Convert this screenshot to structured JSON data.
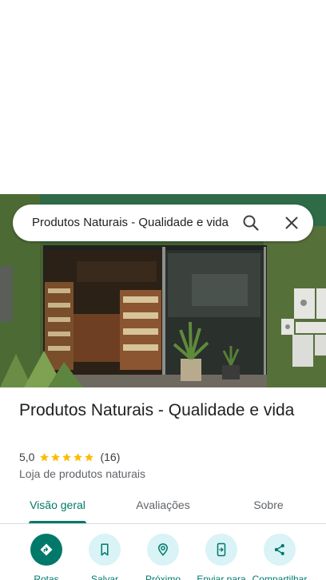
{
  "search": {
    "query": "Produtos Naturais - Qualidade e vida"
  },
  "place": {
    "name": "Produtos Naturais - Qualidade e vida",
    "rating": "5,0",
    "stars": 5,
    "review_count": "(16)",
    "category": "Loja de produtos naturais"
  },
  "tabs": [
    {
      "label": "Visão geral",
      "active": true
    },
    {
      "label": "Avaliações",
      "active": false
    },
    {
      "label": "Sobre",
      "active": false
    }
  ],
  "actions": [
    {
      "label": "Rotas",
      "icon": "directions-icon"
    },
    {
      "label": "Salvar",
      "icon": "bookmark-icon"
    },
    {
      "label": "Próximo",
      "icon": "nearby-icon"
    },
    {
      "label": "Enviar para",
      "icon": "send-to-phone-icon"
    },
    {
      "label": "Compartilhar",
      "icon": "share-icon"
    }
  ],
  "colors": {
    "accent": "#00796b",
    "action_bg": "#d9f3f6",
    "star": "#fbbc04"
  }
}
